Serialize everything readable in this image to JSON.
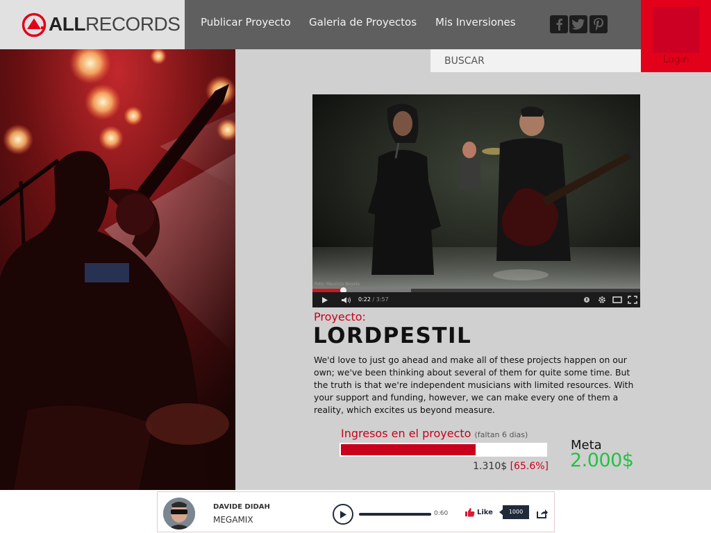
{
  "brand": {
    "logo_text_bold": "ALL",
    "logo_text_light": "RECORDS",
    "accent": "#e2001a"
  },
  "nav": {
    "items": [
      {
        "label": "Publicar Proyecto"
      },
      {
        "label": "Galeria de Proyectos"
      },
      {
        "label": "Mis Inversiones"
      }
    ],
    "social": [
      "facebook-icon",
      "twitter-icon",
      "pinterest-icon"
    ]
  },
  "login": {
    "label": "Login"
  },
  "search": {
    "placeholder": "BUSCAR"
  },
  "video": {
    "credit": "Foto: Mauricio Noyola",
    "current_time": "0:22",
    "duration": "3:57",
    "played_fraction": 0.093,
    "buffered_fraction": 0.3
  },
  "project": {
    "label": "Proyecto:",
    "name": "LORDPESTIL",
    "description": "We'd love to just go ahead and make all of these projects happen on our own; we've been thinking about several of them for quite some time. But the truth is that we're independent musicians with limited resources. With your support and funding, however, we can make every one of them a reality, which excites us beyond measure."
  },
  "funding": {
    "title": "Ingresos en el proyecto",
    "days_left": "(faltan 6 dias)",
    "raised": "1.310$",
    "percent": "[65.6%]",
    "percent_value": 65.6,
    "goal_label": "Meta",
    "goal_value": "2.000$"
  },
  "player": {
    "artist": "DAVIDE DIDAH",
    "track": "MEGAMIX",
    "time": "0:60",
    "like_label": "Like",
    "like_count": "1000"
  }
}
